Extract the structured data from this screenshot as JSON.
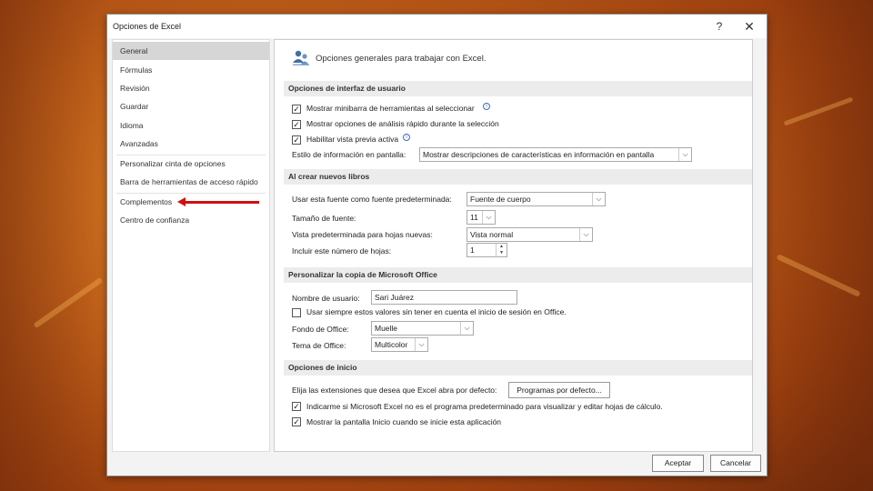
{
  "dialog": {
    "title": "Opciones de Excel",
    "help": "?",
    "close": "✕"
  },
  "sidebar": {
    "items": [
      "General",
      "Fórmulas",
      "Revisión",
      "Guardar",
      "Idioma",
      "Avanzadas",
      "Personalizar cinta de opciones",
      "Barra de herramientas de acceso rápido",
      "Complementos",
      "Centro de confianza"
    ]
  },
  "content": {
    "heading": "Opciones generales para trabajar con Excel.",
    "ui": {
      "title": "Opciones de interfaz de usuario",
      "cb1": "Mostrar minibarra de herramientas al seleccionar",
      "cb2": "Mostrar opciones de análisis rápido durante la selección",
      "cb3": "Habilitar vista previa activa",
      "style_label": "Estilo de información en pantalla:",
      "style_value": "Mostrar descripciones de características en información en pantalla"
    },
    "newbooks": {
      "title": "Al crear nuevos libros",
      "font_label": "Usar esta fuente como fuente predeterminada:",
      "font_value": "Fuente de cuerpo",
      "size_label": "Tamaño de fuente:",
      "size_value": "11",
      "view_label": "Vista predeterminada para hojas nuevas:",
      "view_value": "Vista normal",
      "sheets_label": "Incluir este número de hojas:",
      "sheets_value": "1"
    },
    "personalize": {
      "title": "Personalizar la copia de Microsoft Office",
      "user_label": "Nombre de usuario:",
      "user_value": "Sari Juárez",
      "always_label": "Usar siempre estos valores sin tener en cuenta el inicio de sesión en Office.",
      "bg_label": "Fondo de Office:",
      "bg_value": "Muelle",
      "theme_label": "Tema de Office:",
      "theme_value": "Multicolor"
    },
    "startup": {
      "title": "Opciones de inicio",
      "ext_label": "Elija las extensiones que desea que Excel abra por defecto:",
      "ext_button": "Programas por defecto...",
      "cb_default": "Indicarme si Microsoft Excel no es el programa predeterminado para visualizar y editar hojas de cálculo.",
      "cb_start": "Mostrar la pantalla Inicio cuando se inicie esta aplicación"
    }
  },
  "footer": {
    "ok": "Aceptar",
    "cancel": "Cancelar"
  },
  "icons": {
    "check": "✓",
    "dropdown": "⌵",
    "info": "i",
    "spin_up": "▲",
    "spin_down": "▼"
  }
}
